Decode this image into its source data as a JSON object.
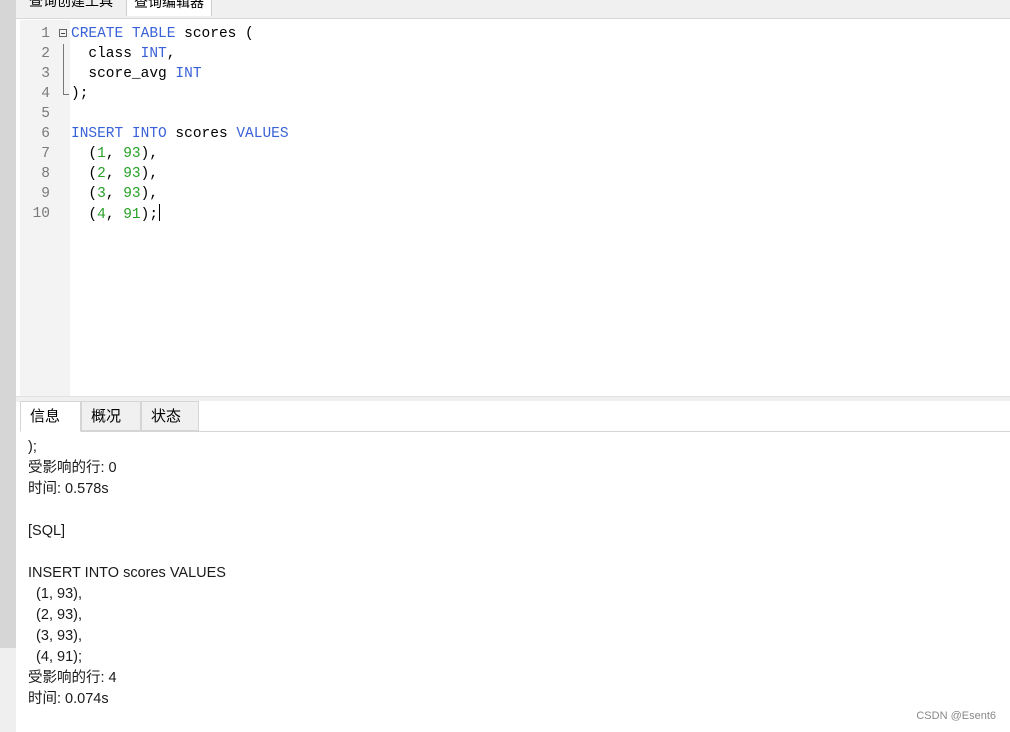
{
  "top_tabs": [
    "查询创建工具",
    "查询编辑器"
  ],
  "editor": {
    "lines": [
      {
        "n": "1",
        "fold": "box",
        "tokens": [
          {
            "t": "CREATE",
            "c": "kw"
          },
          {
            "t": " "
          },
          {
            "t": "TABLE",
            "c": "kw"
          },
          {
            "t": " scores ("
          }
        ]
      },
      {
        "n": "2",
        "fold": "line",
        "tokens": [
          {
            "t": "  class "
          },
          {
            "t": "INT",
            "c": "kw"
          },
          {
            "t": ","
          }
        ]
      },
      {
        "n": "3",
        "fold": "line",
        "tokens": [
          {
            "t": "  score_avg "
          },
          {
            "t": "INT",
            "c": "kw"
          }
        ]
      },
      {
        "n": "4",
        "fold": "corner",
        "tokens": [
          {
            "t": ");"
          }
        ]
      },
      {
        "n": "5",
        "fold": "",
        "tokens": []
      },
      {
        "n": "6",
        "fold": "",
        "tokens": [
          {
            "t": "INSERT",
            "c": "kw"
          },
          {
            "t": " "
          },
          {
            "t": "INTO",
            "c": "kw"
          },
          {
            "t": " scores "
          },
          {
            "t": "VALUES",
            "c": "kw"
          }
        ]
      },
      {
        "n": "7",
        "fold": "",
        "tokens": [
          {
            "t": "  ("
          },
          {
            "t": "1",
            "c": "num"
          },
          {
            "t": ", "
          },
          {
            "t": "93",
            "c": "num"
          },
          {
            "t": "),"
          }
        ]
      },
      {
        "n": "8",
        "fold": "",
        "tokens": [
          {
            "t": "  ("
          },
          {
            "t": "2",
            "c": "num"
          },
          {
            "t": ", "
          },
          {
            "t": "93",
            "c": "num"
          },
          {
            "t": "),"
          }
        ]
      },
      {
        "n": "9",
        "fold": "",
        "tokens": [
          {
            "t": "  ("
          },
          {
            "t": "3",
            "c": "num"
          },
          {
            "t": ", "
          },
          {
            "t": "93",
            "c": "num"
          },
          {
            "t": "),"
          }
        ]
      },
      {
        "n": "10",
        "fold": "",
        "tokens": [
          {
            "t": "  ("
          },
          {
            "t": "4",
            "c": "num"
          },
          {
            "t": ", "
          },
          {
            "t": "91",
            "c": "num"
          },
          {
            "t": ");"
          }
        ],
        "caret": true
      }
    ]
  },
  "result_tabs": {
    "info": "信息",
    "overview": "概况",
    "status": "状态"
  },
  "messages": [
    ");",
    "受影响的行: 0",
    "时间: 0.578s",
    "",
    "[SQL]",
    "",
    "INSERT INTO scores VALUES",
    "  (1, 93),",
    "  (2, 93),",
    "  (3, 93),",
    "  (4, 91);",
    "受影响的行: 4",
    "时间: 0.074s"
  ],
  "watermark": "CSDN @Esent6",
  "colors": {
    "keyword": "#3a62d8",
    "number": "#28a028"
  }
}
